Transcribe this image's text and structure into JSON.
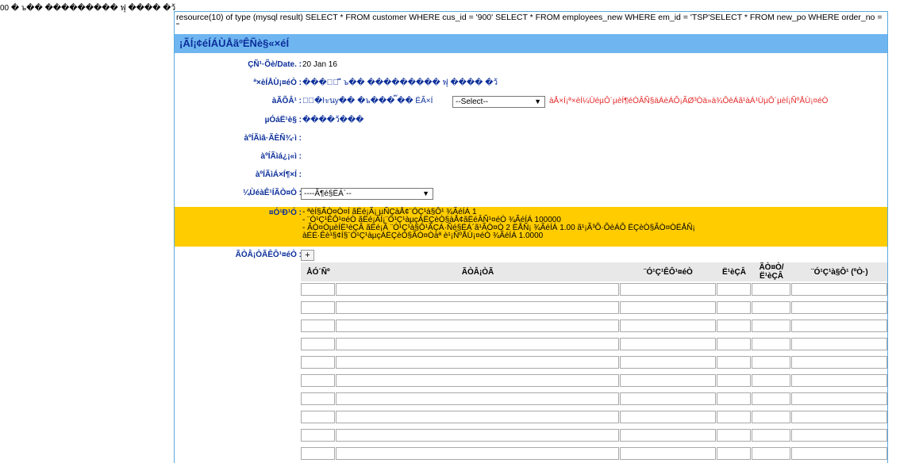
{
  "top_text": "00 � ъ�� ��������� ฟุ ���� �ว้",
  "debug_text": "resource(10) of type (mysql result) SELECT * FROM customer WHERE cus_id = '900' SELECT * FROM employees_new WHERE em_id = 'TSP'SELECT * FROM new_po WHERE order_no = ''",
  "title": "¡ÃÍ¡¢éÍÁÙÅãºÊÑè§«×éÍ",
  "form": {
    "date_label": "ÇÑ¹·Õè/Date. :",
    "date_value": "20 Jan 16",
    "customer_label": "ª×èÍÅÙ¡¤éÒ :",
    "customer_value": "����ั  ี  ъ�� ��������� ฟุ  ���� �ว้",
    "contact_label": "àÃÕÂ¹ :",
    "contact_value": "�ุ�ŀะนy�� �ъ���  ๊��  ËÃ×Í",
    "contact_select": "--Select--",
    "contact_warning": "àÅ×Í¡ª×èÍ¼ÙéµÔ´µèÍ¶éÒÂÑ§äÁèÁÕ¡ÃØ³Òä»à¾ÔèÁã¹àÁ¹ÙµÔ´µèÍ¡ÑºÅÙ¡¤éÒ",
    "subject_label": "µÓáË¹è§ :",
    "subject_value": "����ว้���",
    "tel_label": "àºÍÃìâ·ÃÈÑ¾·ì :",
    "fax_label": "àºÍÃìá¿¡«ì :",
    "email_label": "àºÍÃìÁ×Í¶×Í :",
    "sales_label": "¼ÙéàÊ¹ÍÃÒ¤Ò :",
    "sales_select": "----Ã¶é§ËÁ´--",
    "note_label": "¤Ó¹Ð¹Ó :",
    "note_lines": [
      "-  ªèÍ§ÃÒ¤Ò¤Í ãËé¡Ã¡ µÑÇàÅ¢¨ÓÇ¹à§Ô¹ ¾ÃéÍÁ 1",
      "-  ¨Ó¹Ç¹ÊÔ¹¤éÒ ãËé¡ÃÍ¡¨Ó¹Ç¹àµçÁËÇèÒ§àÅ¢ãËéÂÑ¹¤éÒ ¾ÃéÍÁ 100000",
      "-  ÃÒ¤ÒµèÍË¹èÇÂ ãËé¡Ã ¨Ó¹Ç¹à§Ô¹ÃÇÁ·Ñé§ËÁ´ã¹ÃÒ¤Ò 2 ËÅÑ¡ ¾ÃéÍÁ 1.00    ã¹¡Ã³Õ·ÕèÁÕ ËÇèÒ§ÃÒ¤ÒËÅÑ¡",
      "àÉÉ·Êè¹§¢Í§¨Ó¹Ç¹àµçÁËÇèÒ§ÃÒ¤Òàª è¹¡ÑºÅÙ¡¤éÒ ¾ÃéÍÁ 1.0000"
    ],
    "items_label": "ÃÒÂ¡ÒÃÊÔ¹¤éÒ :",
    "add_button": "+"
  },
  "grid": {
    "columns": [
      "ÅÓ´Ñº",
      "ÃÒÂ¡ÒÃ",
      "¨Ó¹Ç¹ÊÔ¹¤éÒ",
      "Ë¹èÇÂ",
      "ÃÒ¤Ò/Ë¹èÇÂ",
      "¨Ó¹Ç¹à§Ô¹ (ºÒ·)"
    ],
    "row_count": 10
  }
}
